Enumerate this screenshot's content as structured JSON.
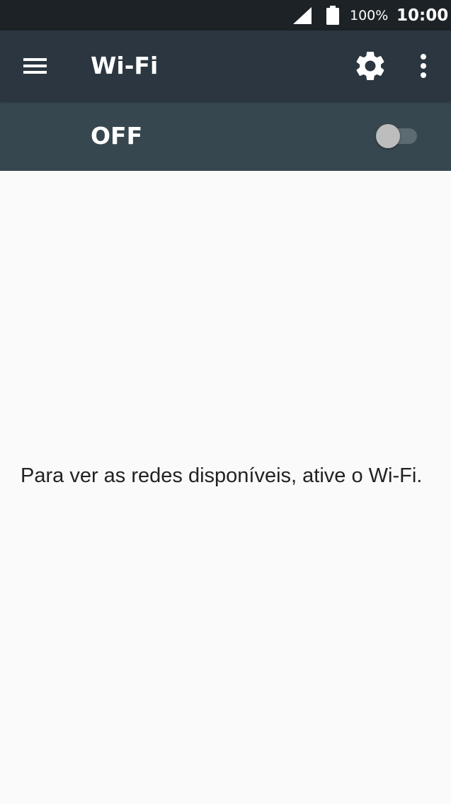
{
  "status_bar": {
    "battery_percent": "100%",
    "time": "10:00",
    "icons": [
      "cell-signal-icon",
      "battery-icon"
    ]
  },
  "app_bar": {
    "title": "Wi-Fi",
    "icons": [
      "menu-icon",
      "gear-icon",
      "more-vert-icon"
    ]
  },
  "switch_bar": {
    "status_label": "OFF",
    "toggle_on": false
  },
  "content": {
    "empty_message": "Para ver as redes disponíveis, ative o Wi-Fi."
  },
  "colors": {
    "status_bar_bg": "#1c2226",
    "app_bar_bg": "#2b3640",
    "switch_bar_bg": "#37474f",
    "content_bg": "#fafafa",
    "toggle_thumb_off": "#bdbdbd",
    "toggle_track_off": "#5c6a72"
  }
}
